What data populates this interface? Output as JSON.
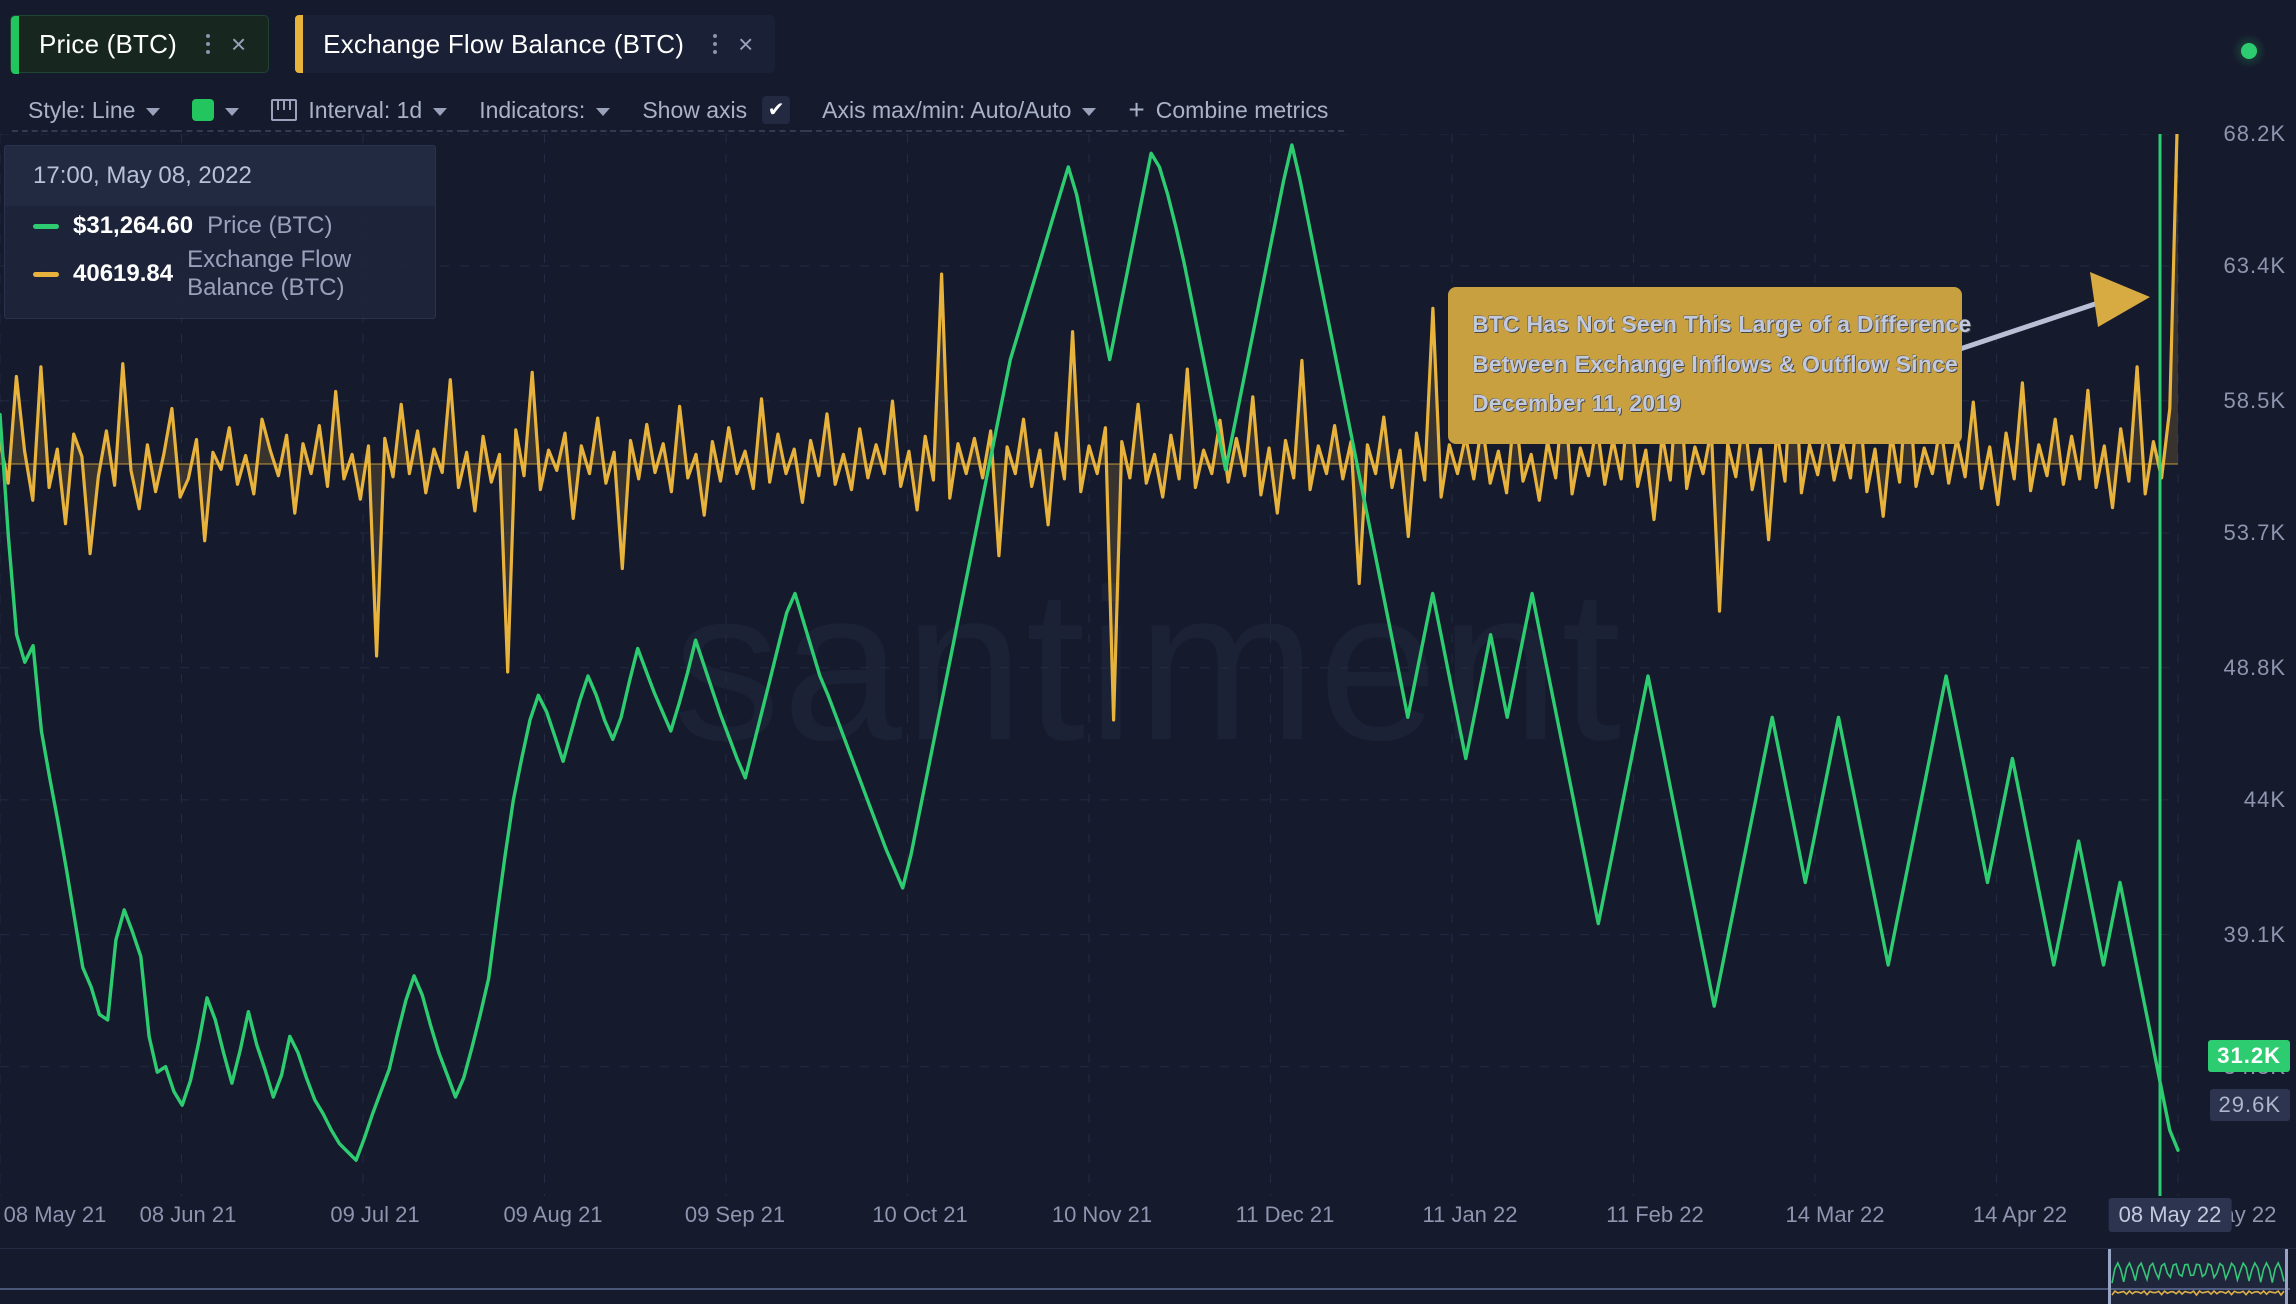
{
  "tabs": [
    {
      "label": "Price (BTC)",
      "accent_color": "#22c55e",
      "active": true,
      "menu_icon": "kebab-menu-icon",
      "close_icon": "close-icon"
    },
    {
      "label": "Exchange Flow Balance (BTC)",
      "accent_color": "#e8b33c",
      "active": false,
      "menu_icon": "kebab-menu-icon",
      "close_icon": "close-icon"
    }
  ],
  "status": {
    "indicator": "live-status-dot",
    "color": "#2ecc71"
  },
  "toolbar": {
    "style_label": "Style: Line",
    "color_swatch": "#22c55e",
    "interval_label": "Interval: 1d",
    "indicators_label": "Indicators:",
    "show_axis_label": "Show axis",
    "show_axis_checked": true,
    "show_axis_check_glyph": "✔",
    "axis_minmax_label": "Axis max/min: Auto/Auto",
    "axis_minmax_checked": true,
    "axis_minmax_check_glyph": "✔",
    "combine_label": "Combine metrics",
    "combine_plus": "+"
  },
  "tooltip": {
    "date": "17:00, May 08, 2022",
    "rows": [
      {
        "value": "$31,264.60",
        "name": "Price (BTC)",
        "color": "#2ecc71"
      },
      {
        "value": "40619.84",
        "name": "Exchange Flow Balance (BTC)",
        "color": "#e8b33c"
      }
    ]
  },
  "annotation": {
    "lines": [
      "BTC Has Not Seen This Large of a Difference",
      "Between Exchange Inflows & Outflow Since",
      "December 11, 2019"
    ],
    "background": "#c8a03f",
    "arrow": "annotation-arrow"
  },
  "watermark": "santiment",
  "cursor": {
    "x_label": "08 May 22",
    "price_badge": "31.2K",
    "flow_badge": "29.6K"
  },
  "chart_data": {
    "type": "line",
    "title": "",
    "xlabel": "",
    "ylabel": "",
    "grid": true,
    "legend_position": "top-left",
    "x_tick_labels": [
      "08 May 21",
      "08 Jun 21",
      "09 Jul 21",
      "09 Aug 21",
      "09 Sep 21",
      "10 Oct 21",
      "10 Nov 21",
      "11 Dec 21",
      "11 Jan 22",
      "11 Feb 22",
      "14 Mar 22",
      "14 Apr 22",
      "16 May 22"
    ],
    "y_tick_labels": [
      "68.2K",
      "63.4K",
      "58.5K",
      "53.7K",
      "48.8K",
      "44K",
      "39.1K",
      "34.3K"
    ],
    "ylim": [
      29600,
      68200
    ],
    "series": [
      {
        "name": "Price (BTC)",
        "color": "#2ecc71",
        "axis": "left",
        "units": "USD",
        "values": [
          58000,
          53600,
          50000,
          49000,
          49600,
          46500,
          44800,
          43200,
          41500,
          39700,
          37900,
          37200,
          36200,
          36000,
          38900,
          40000,
          39200,
          38300,
          35400,
          34100,
          34300,
          33400,
          32900,
          33800,
          35200,
          36800,
          36000,
          34800,
          33700,
          34900,
          36300,
          35100,
          34200,
          33200,
          34000,
          35400,
          34800,
          33900,
          33100,
          32600,
          32000,
          31500,
          31200,
          30900,
          31700,
          32600,
          33400,
          34200,
          35500,
          36700,
          37600,
          36900,
          35800,
          34800,
          34000,
          33200,
          33900,
          35000,
          36200,
          37500,
          39800,
          42000,
          44000,
          45500,
          46900,
          47800,
          47200,
          46300,
          45400,
          46500,
          47600,
          48500,
          47800,
          46900,
          46200,
          47000,
          48300,
          49500,
          48700,
          47900,
          47200,
          46500,
          47500,
          48600,
          49800,
          48900,
          48000,
          47100,
          46300,
          45500,
          44800,
          46000,
          47200,
          48400,
          49600,
          50800,
          51500,
          50500,
          49500,
          48500,
          47800,
          47000,
          46200,
          45400,
          44600,
          43800,
          43000,
          42200,
          41500,
          40800,
          42000,
          43500,
          45000,
          46500,
          48000,
          49500,
          51000,
          52500,
          54000,
          55500,
          57000,
          58500,
          60000,
          61000,
          62000,
          63000,
          64000,
          65000,
          66000,
          67000,
          66000,
          64500,
          63000,
          61500,
          60000,
          61500,
          63000,
          64500,
          66000,
          67500,
          67000,
          66000,
          64800,
          63500,
          62000,
          60500,
          59000,
          57500,
          56000,
          57500,
          59000,
          60500,
          62000,
          63500,
          65000,
          66500,
          67800,
          66500,
          65000,
          63500,
          62000,
          60500,
          59000,
          57500,
          56000,
          54500,
          53000,
          51500,
          50000,
          48500,
          47000,
          48500,
          50000,
          51500,
          50000,
          48500,
          47000,
          45500,
          47000,
          48500,
          50000,
          48500,
          47000,
          48500,
          50000,
          51500,
          50000,
          48500,
          47000,
          45500,
          44000,
          42500,
          41000,
          39500,
          41000,
          42500,
          44000,
          45500,
          47000,
          48500,
          47000,
          45500,
          44000,
          42500,
          41000,
          39500,
          38000,
          36500,
          38000,
          39500,
          41000,
          42500,
          44000,
          45500,
          47000,
          45500,
          44000,
          42500,
          41000,
          42500,
          44000,
          45500,
          47000,
          45500,
          44000,
          42500,
          41000,
          39500,
          38000,
          39500,
          41000,
          42500,
          44000,
          45500,
          47000,
          48500,
          47000,
          45500,
          44000,
          42500,
          41000,
          42500,
          44000,
          45500,
          44000,
          42500,
          41000,
          39500,
          38000,
          39500,
          41000,
          42500,
          41000,
          39500,
          38000,
          39500,
          41000,
          39500,
          38000,
          36500,
          35000,
          33500,
          32000,
          31264
        ]
      },
      {
        "name": "Exchange Flow Balance (BTC)",
        "color": "#e8b33c",
        "axis": "right",
        "units": "BTC",
        "baseline": 0,
        "note": "Oscillates around a zero reference line with occasional large negative outflow spikes; final value spikes strongly positive.",
        "final_value": 40619.84,
        "values": [
          2100,
          -1800,
          8200,
          1200,
          -3400,
          9100,
          -2200,
          1400,
          -5600,
          2800,
          700,
          -8400,
          -1200,
          3100,
          -2000,
          9400,
          -600,
          -4200,
          1800,
          -2600,
          900,
          5200,
          -3100,
          -1400,
          2300,
          -7200,
          1100,
          -500,
          3400,
          -1900,
          800,
          -2800,
          4200,
          1300,
          -1100,
          2700,
          -4600,
          1900,
          -900,
          3600,
          -2100,
          6800,
          -1400,
          900,
          -3300,
          1700,
          -18000,
          2400,
          -1200,
          5600,
          -900,
          3100,
          -2700,
          1400,
          -800,
          7900,
          -2200,
          1100,
          -4400,
          2600,
          -1700,
          900,
          -19500,
          3200,
          -1100,
          8600,
          -2400,
          1300,
          -600,
          2900,
          -5100,
          1700,
          -900,
          4300,
          -1800,
          1100,
          -9800,
          2200,
          -1400,
          3700,
          -800,
          1900,
          -2600,
          5400,
          -1300,
          900,
          -4800,
          2100,
          -1600,
          3400,
          -900,
          1200,
          -2300,
          6100,
          -1700,
          2800,
          -900,
          1400,
          -3600,
          2200,
          -1100,
          4700,
          -1900,
          900,
          -2400,
          3300,
          -1300,
          1800,
          -900,
          5900,
          -2100,
          1200,
          -4300,
          2600,
          -1500,
          17800,
          -3200,
          1900,
          -900,
          2400,
          -1300,
          3100,
          -8600,
          1600,
          -900,
          4200,
          -2100,
          1300,
          -5700,
          2900,
          -1400,
          12400,
          -2600,
          1700,
          -900,
          3400,
          -24000,
          2100,
          -1300,
          5600,
          -1800,
          900,
          -3100,
          2700,
          -1400,
          8900,
          -2200,
          1300,
          -900,
          4100,
          -1700,
          2400,
          -1100,
          6300,
          -2900,
          1500,
          -4600,
          2200,
          -1300,
          9700,
          -2400,
          1700,
          -900,
          3600,
          -1400,
          2100,
          -11200,
          1800,
          -900,
          4400,
          -2200,
          1300,
          -6800,
          2900,
          -1500,
          14600,
          -3100,
          1800,
          -900,
          2600,
          -1400,
          3900,
          -1800,
          1200,
          -2700,
          5300,
          -1600,
          900,
          -3400,
          2100,
          -1300,
          7200,
          -2800,
          1500,
          -1100,
          3800,
          -1900,
          2300,
          -1400,
          6700,
          -2100,
          1300,
          -5200,
          2700,
          -1500,
          9400,
          -2300,
          1600,
          -900,
          3200,
          -13800,
          1900,
          -1200,
          4800,
          -2400,
          1400,
          -7100,
          3100,
          -1600,
          11900,
          -2700,
          1800,
          -1000,
          3500,
          -1500,
          2200,
          -1300,
          6100,
          -2600,
          1400,
          -4900,
          2800,
          -1700,
          8300,
          -2100,
          1500,
          -900,
          3700,
          -1800,
          2400,
          -1200,
          5800,
          -2300,
          1600,
          -3800,
          2900,
          -1400,
          7600,
          -2500,
          1800,
          -1100,
          4200,
          -1900,
          2600,
          -1400,
          6900,
          -2200,
          1700,
          -4100,
          3300,
          -1600,
          9100,
          -2800,
          2100,
          -1300,
          5200,
          40619
        ]
      }
    ]
  }
}
